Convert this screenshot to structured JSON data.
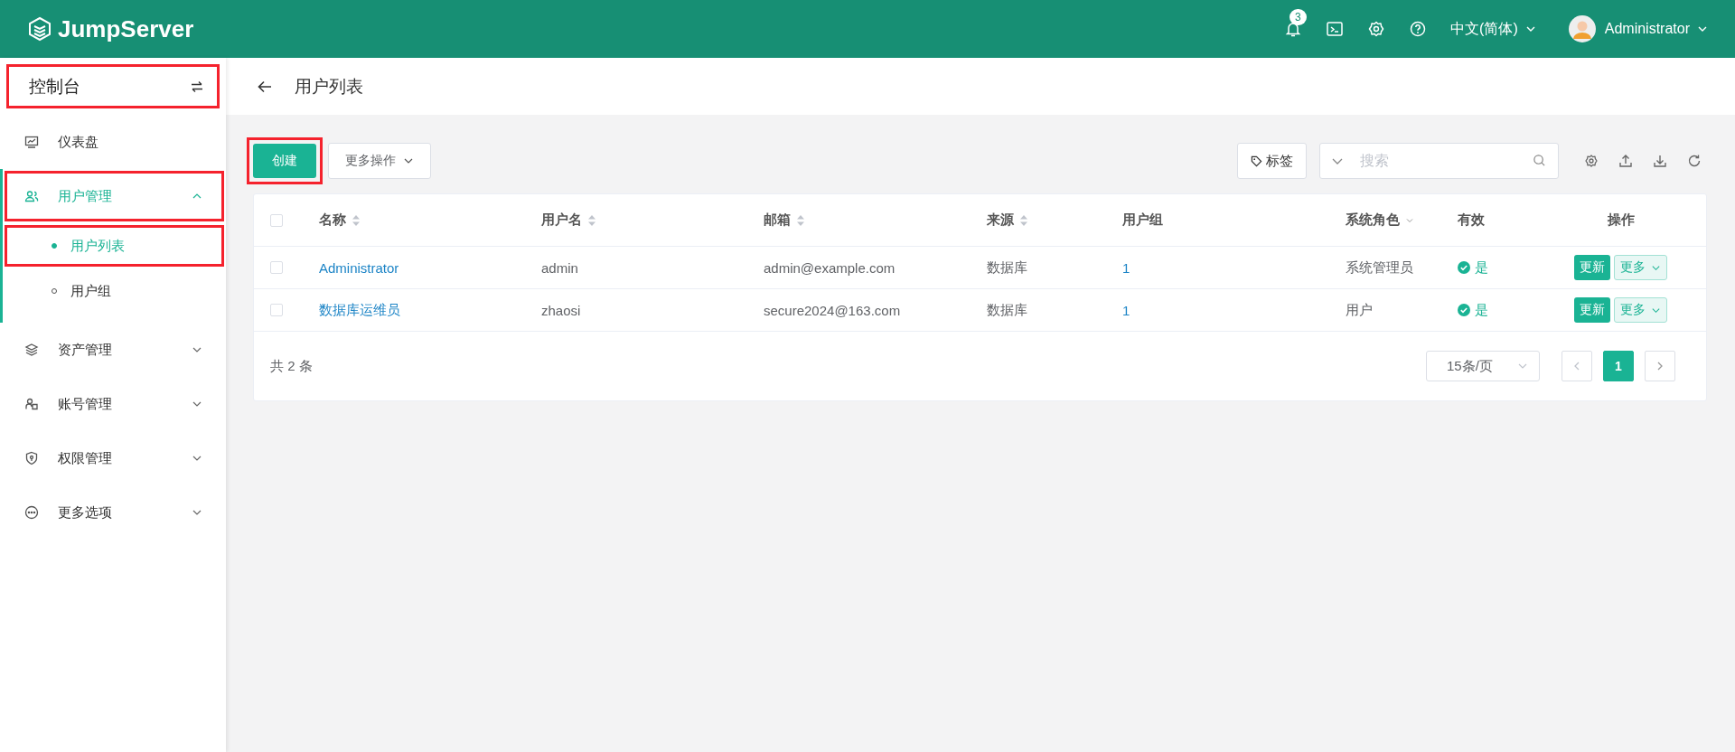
{
  "header": {
    "logo": "JumpServer",
    "notification_count": "3",
    "language": "中文(简体)",
    "user": "Administrator"
  },
  "sidebar": {
    "title": "控制台",
    "title_highlighted": true,
    "items": [
      {
        "label": "仪表盘",
        "expanded": false,
        "selected": false,
        "highlighted": false,
        "has_children": false
      },
      {
        "label": "用户管理",
        "expanded": true,
        "selected": true,
        "highlighted": true,
        "has_children": true,
        "children": [
          {
            "label": "用户列表",
            "selected": true,
            "highlighted": true
          },
          {
            "label": "用户组",
            "selected": false,
            "highlighted": false
          }
        ]
      },
      {
        "label": "资产管理",
        "expanded": false,
        "selected": false,
        "highlighted": false,
        "has_children": true
      },
      {
        "label": "账号管理",
        "expanded": false,
        "selected": false,
        "highlighted": false,
        "has_children": true
      },
      {
        "label": "权限管理",
        "expanded": false,
        "selected": false,
        "highlighted": false,
        "has_children": true
      },
      {
        "label": "更多选项",
        "expanded": false,
        "selected": false,
        "highlighted": false,
        "has_children": true
      }
    ]
  },
  "page": {
    "title": "用户列表"
  },
  "toolbar": {
    "create": {
      "label": "创建",
      "highlighted": true
    },
    "more_actions": "更多操作",
    "tag_button": "标签",
    "search": {
      "placeholder": "搜索"
    }
  },
  "table": {
    "select_all_checked": false,
    "columns": [
      {
        "label": "名称",
        "sortable": true,
        "filterable": false
      },
      {
        "label": "用户名",
        "sortable": true,
        "filterable": false
      },
      {
        "label": "邮箱",
        "sortable": true,
        "filterable": false
      },
      {
        "label": "来源",
        "sortable": true,
        "filterable": false
      },
      {
        "label": "用户组",
        "sortable": false,
        "filterable": false
      },
      {
        "label": "系统角色",
        "sortable": false,
        "filterable": true
      },
      {
        "label": "有效",
        "sortable": false,
        "filterable": false
      },
      {
        "label": "操作",
        "sortable": false,
        "filterable": false
      }
    ],
    "rows": [
      {
        "checked": false,
        "name": "Administrator",
        "username": "admin",
        "email": "admin@example.com",
        "source": "数据库",
        "groups": "1",
        "role": "系统管理员",
        "active": true,
        "active_label": "是",
        "update": "更新",
        "more": "更多"
      },
      {
        "checked": false,
        "name": "数据库运维员",
        "username": "zhaosi",
        "email": "secure2024@163.com",
        "source": "数据库",
        "groups": "1",
        "role": "用户",
        "active": true,
        "active_label": "是",
        "update": "更新",
        "more": "更多"
      }
    ]
  },
  "pagination": {
    "total": "共 2 条",
    "page_size": "15条/页",
    "pages": [
      {
        "label": "1",
        "selected": true
      }
    ]
  }
}
